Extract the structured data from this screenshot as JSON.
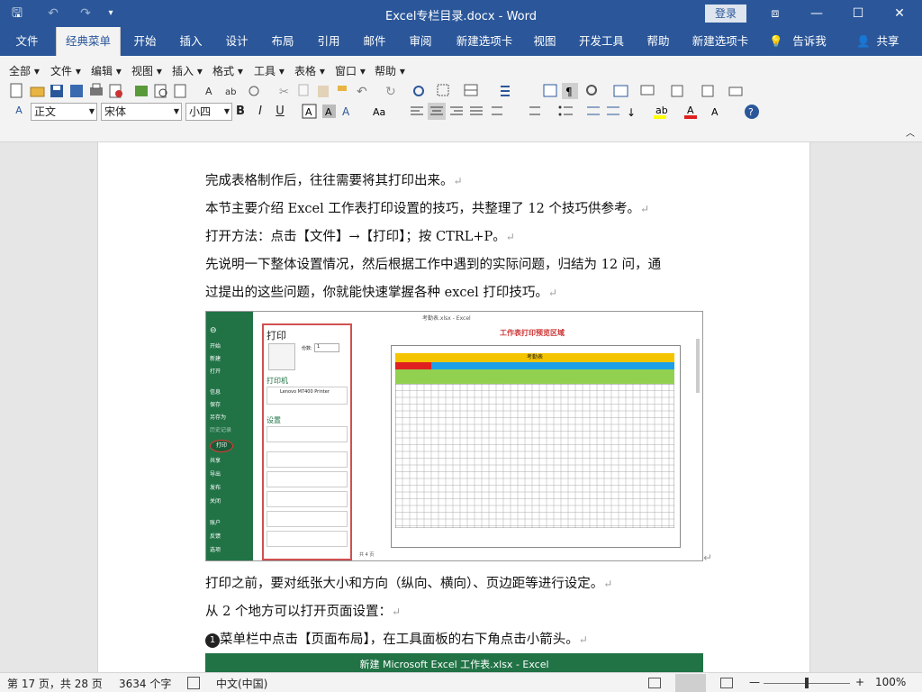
{
  "window": {
    "title": "Excel专栏目录.docx - Word",
    "login": "登录",
    "controls": [
      "⧈",
      "—",
      "☐",
      "✕"
    ]
  },
  "qat": {
    "save": "🖫",
    "undo": "↶",
    "redo": "↷",
    "more": "▾"
  },
  "ribbon_tabs": [
    "文件",
    "经典菜单",
    "开始",
    "插入",
    "设计",
    "布局",
    "引用",
    "邮件",
    "审阅",
    "新建选项卡",
    "视图",
    "开发工具",
    "帮助",
    "新建选项卡",
    "告诉我",
    "共享"
  ],
  "active_tab": 1,
  "menus": [
    "全部",
    "文件",
    "编辑",
    "视图",
    "插入",
    "格式",
    "工具",
    "表格",
    "窗口",
    "帮助"
  ],
  "format": {
    "style": "正文",
    "font": "宋体",
    "size": "小四"
  },
  "icons": {
    "bold": "B",
    "italic": "I",
    "underline": "U",
    "tell_me": "💡",
    "share": "👤"
  },
  "document": {
    "paragraphs": [
      "完成表格制作后，往往需要将其打印出来。",
      "本节主要介绍 Excel 工作表打印设置的技巧，共整理了 12 个技巧供参考。",
      "打开方法：点击【文件】→【打印】；按 CTRL+P。",
      "先说明一下整体设置情况，然后根据工作中遇到的实际问题，归结为 12 问，通",
      "过提出的这些问题，你就能快速掌握各种 excel 打印技巧。"
    ],
    "after_image": [
      "打印之前，要对纸张大小和方向（纵向、横向）、页边距等进行设定。",
      "从 2 个地方可以打开页面设置：",
      "菜单栏中点击【页面布局】，在工具面板的右下角点击小箭头。"
    ],
    "bullet_number": "1",
    "para_mark": "↵",
    "embedded": {
      "window_title": "考勤表.xlsx - Excel",
      "panel_title": "打印",
      "printer_section": "打印机",
      "printer_name": "Lenovo M7400 Printer",
      "settings_section": "设置",
      "copies_label": "份数:",
      "copies_value": "1",
      "preview_title": "工作表打印预览区域",
      "sheet_title": "考勤表",
      "menu_items": [
        "开始",
        "新建",
        "打开",
        "信息",
        "保存",
        "另存为",
        "历史记录",
        "打印",
        "共享",
        "导出",
        "发布",
        "关闭",
        "账户",
        "反馈",
        "选项"
      ],
      "page_nav": "共 4 页"
    },
    "second_title": "新建 Microsoft Excel 工作表.xlsx - Excel"
  },
  "status": {
    "page": "第 17 页，共 28 页",
    "words": "3634 个字",
    "lang": "中文(中国)",
    "zoom": "100%",
    "zoom_minus": "—",
    "zoom_plus": "+"
  }
}
